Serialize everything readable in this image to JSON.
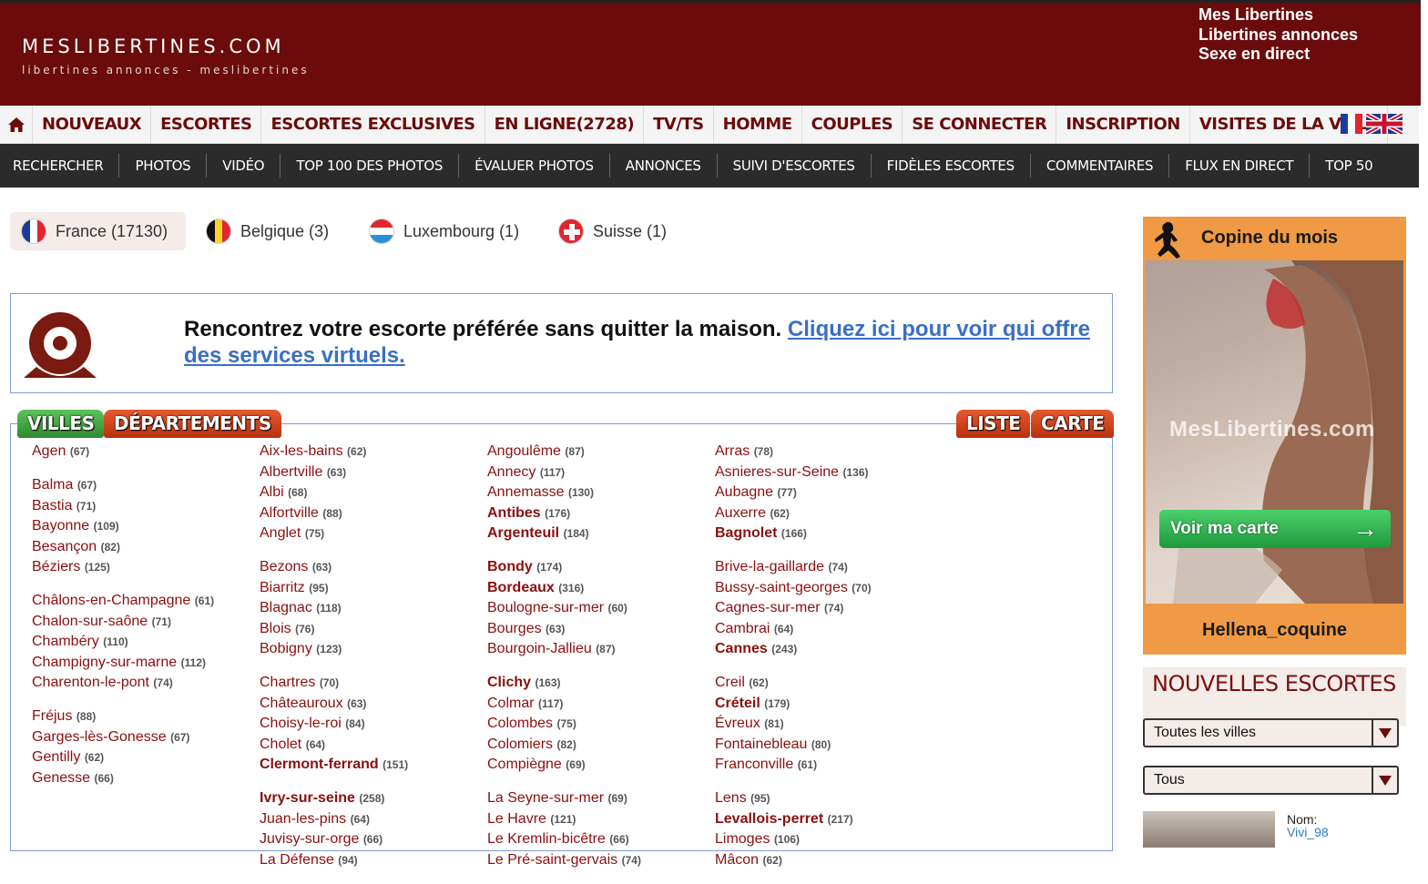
{
  "header": {
    "logo_title": "MESLIBERTINES.COM",
    "logo_sub": "libertines annonces - meslibertines",
    "links": [
      "Mes Libertines",
      "Libertines annonces",
      "Sexe en direct"
    ],
    "color": "#6b0b0b"
  },
  "mainnav": [
    "NOUVEAUX",
    "ESCORTES",
    "ESCORTES EXCLUSIVES",
    "EN LIGNE(2728)",
    "TV/TS",
    "HOMME",
    "COUPLES",
    "SE CONNECTER",
    "INSCRIPTION",
    "VISITES DE LA VILLE"
  ],
  "subnav": [
    "RECHERCHER",
    "PHOTOS",
    "VIDÉO",
    "TOP 100 DES PHOTOS",
    "ÉVALUER PHOTOS",
    "ANNONCES",
    "SUIVI D'ESCORTES",
    "FIDÈLES ESCORTES",
    "COMMENTAIRES",
    "FLUX EN DIRECT",
    "TOP 50"
  ],
  "countries": [
    {
      "label": "France (17130)",
      "flag": "france-flag-icon",
      "active": true
    },
    {
      "label": "Belgique (3)",
      "flag": "belgium-flag-icon"
    },
    {
      "label": "Luxembourg (1)",
      "flag": "luxembourg-flag-icon"
    },
    {
      "label": "Suisse (1)",
      "flag": "switzerland-flag-icon"
    }
  ],
  "banner": {
    "text": "Rencontrez votre escorte préférée sans quitter la maison. ",
    "link": "Cliquez ici pour voir qui offre des services virtuels."
  },
  "tabs": {
    "villes": "VILLES",
    "departements": "DÉPARTEMENTS",
    "liste": "LISTE",
    "carte": "CARTE"
  },
  "cities": [
    [
      [
        {
          "n": "Agen",
          "c": "(67)"
        }
      ],
      [
        {
          "n": "Balma",
          "c": "(67)"
        },
        {
          "n": "Bastia",
          "c": "(71)"
        },
        {
          "n": "Bayonne",
          "c": "(109)"
        },
        {
          "n": "Besançon",
          "c": "(82)"
        },
        {
          "n": "Béziers",
          "c": "(125)"
        }
      ],
      [
        {
          "n": "Châlons-en-Champagne",
          "c": "(61)"
        },
        {
          "n": "Chalon-sur-saône",
          "c": "(71)"
        },
        {
          "n": "Chambéry",
          "c": "(110)"
        },
        {
          "n": "Champigny-sur-marne",
          "c": "(112)"
        },
        {
          "n": "Charenton-le-pont",
          "c": "(74)"
        }
      ],
      [
        {
          "n": "Fréjus",
          "c": "(88)"
        },
        {
          "n": "Garges-lès-Gonesse",
          "c": "(67)"
        },
        {
          "n": "Gentilly",
          "c": "(62)"
        },
        {
          "n": "Genesse",
          "c": "(66)"
        }
      ]
    ],
    [
      [
        {
          "n": "Aix-les-bains",
          "c": "(62)"
        },
        {
          "n": "Albertville",
          "c": "(63)"
        },
        {
          "n": "Albi",
          "c": "(68)"
        },
        {
          "n": "Alfortville",
          "c": "(88)"
        },
        {
          "n": "Anglet",
          "c": "(75)"
        }
      ],
      [
        {
          "n": "Bezons",
          "c": "(63)"
        },
        {
          "n": "Biarritz",
          "c": "(95)"
        },
        {
          "n": "Blagnac",
          "c": "(118)"
        },
        {
          "n": "Blois",
          "c": "(76)"
        },
        {
          "n": "Bobigny",
          "c": "(123)"
        }
      ],
      [
        {
          "n": "Chartres",
          "c": "(70)"
        },
        {
          "n": "Châteauroux",
          "c": "(63)"
        },
        {
          "n": "Choisy-le-roi",
          "c": "(84)"
        },
        {
          "n": "Cholet",
          "c": "(64)"
        },
        {
          "n": "Clermont-ferrand",
          "c": "(151)",
          "b": true
        }
      ],
      [
        {
          "n": "Ivry-sur-seine",
          "c": "(258)",
          "b": true
        },
        {
          "n": "Juan-les-pins",
          "c": "(64)"
        },
        {
          "n": "Juvisy-sur-orge",
          "c": "(66)"
        },
        {
          "n": "La Défense",
          "c": "(94)"
        }
      ]
    ],
    [
      [
        {
          "n": "Angoulême",
          "c": "(87)"
        },
        {
          "n": "Annecy",
          "c": "(117)"
        },
        {
          "n": "Annemasse",
          "c": "(130)"
        },
        {
          "n": "Antibes",
          "c": "(176)",
          "b": true
        },
        {
          "n": "Argenteuil",
          "c": "(184)",
          "b": true
        }
      ],
      [
        {
          "n": "Bondy",
          "c": "(174)",
          "b": true
        },
        {
          "n": "Bordeaux",
          "c": "(316)",
          "b": true
        },
        {
          "n": "Boulogne-sur-mer",
          "c": "(60)"
        },
        {
          "n": "Bourges",
          "c": "(63)"
        },
        {
          "n": "Bourgoin-Jallieu",
          "c": "(87)"
        }
      ],
      [
        {
          "n": "Clichy",
          "c": "(163)",
          "b": true
        },
        {
          "n": "Colmar",
          "c": "(117)"
        },
        {
          "n": "Colombes",
          "c": "(75)"
        },
        {
          "n": "Colomiers",
          "c": "(82)"
        },
        {
          "n": "Compiègne",
          "c": "(69)"
        }
      ],
      [
        {
          "n": "La Seyne-sur-mer",
          "c": "(69)"
        },
        {
          "n": "Le Havre",
          "c": "(121)"
        },
        {
          "n": "Le Kremlin-bicêtre",
          "c": "(66)"
        },
        {
          "n": "Le Pré-saint-gervais",
          "c": "(74)"
        }
      ]
    ],
    [
      [
        {
          "n": "Arras",
          "c": "(78)"
        },
        {
          "n": "Asnieres-sur-Seine",
          "c": "(136)"
        },
        {
          "n": "Aubagne",
          "c": "(77)"
        },
        {
          "n": "Auxerre",
          "c": "(62)"
        },
        {
          "n": "Bagnolet",
          "c": "(166)",
          "b": true
        }
      ],
      [
        {
          "n": "Brive-la-gaillarde",
          "c": "(74)"
        },
        {
          "n": "Bussy-saint-georges",
          "c": "(70)"
        },
        {
          "n": "Cagnes-sur-mer",
          "c": "(74)"
        },
        {
          "n": "Cambrai",
          "c": "(64)"
        },
        {
          "n": "Cannes",
          "c": "(243)",
          "b": true
        }
      ],
      [
        {
          "n": "Creil",
          "c": "(62)"
        },
        {
          "n": "Créteil",
          "c": "(179)",
          "b": true
        },
        {
          "n": "Évreux",
          "c": "(81)"
        },
        {
          "n": "Fontainebleau",
          "c": "(80)"
        },
        {
          "n": "Franconville",
          "c": "(61)"
        }
      ],
      [
        {
          "n": "Lens",
          "c": "(95)"
        },
        {
          "n": "Levallois-perret",
          "c": "(217)",
          "b": true
        },
        {
          "n": "Limoges",
          "c": "(106)"
        },
        {
          "n": "Mâcon",
          "c": "(62)"
        }
      ]
    ]
  ],
  "sidebar": {
    "copine_title": "Copine du mois",
    "watermark": "MesLibertines.com",
    "voir_label": "Voir ma carte",
    "copine_name": "Hellena_coquine",
    "nouvelles_title": "NOUVELLES ESCORTES",
    "select_city": "Toutes les villes",
    "select_type": "Tous",
    "nom_label": "Nom:",
    "nom_value": "Vivi_98",
    "accent": "#f09a45"
  }
}
